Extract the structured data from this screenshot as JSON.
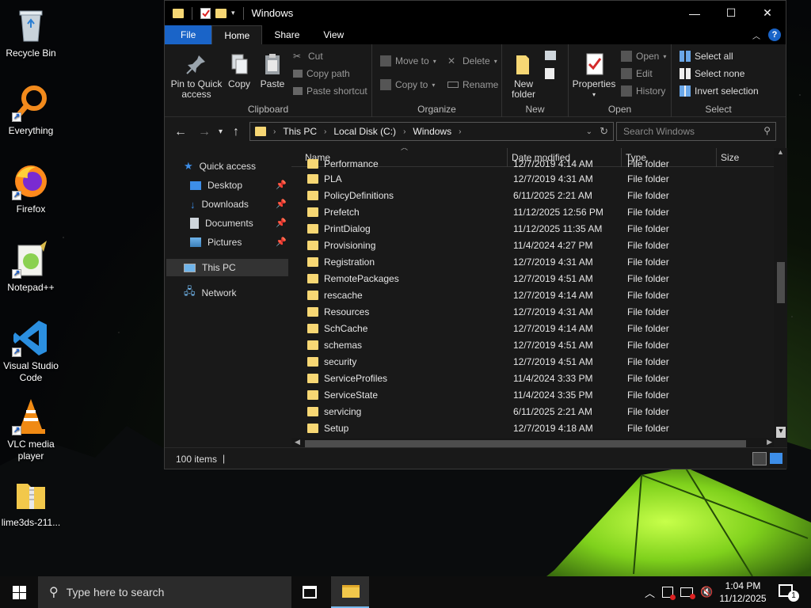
{
  "desktop": {
    "icons": [
      {
        "label": "Recycle Bin"
      },
      {
        "label": "Everything"
      },
      {
        "label": "Firefox"
      },
      {
        "label": "Notepad++"
      },
      {
        "label": "Visual Studio Code"
      },
      {
        "label": "VLC media player"
      },
      {
        "label": "lime3ds-211..."
      }
    ]
  },
  "window": {
    "title": "Windows",
    "controls": {
      "minimize": "—",
      "maximize": "☐",
      "close": "✕"
    }
  },
  "ribbon_tabs": [
    "File",
    "Home",
    "Share",
    "View"
  ],
  "ribbon": {
    "clipboard": {
      "label": "Clipboard",
      "pin": "Pin to Quick access",
      "copy": "Copy",
      "paste": "Paste",
      "cut": "Cut",
      "copy_path": "Copy path",
      "paste_shortcut": "Paste shortcut"
    },
    "organize": {
      "label": "Organize",
      "move_to": "Move to",
      "copy_to": "Copy to",
      "delete": "Delete",
      "rename": "Rename"
    },
    "new": {
      "label": "New",
      "new_folder": "New folder"
    },
    "open": {
      "label": "Open",
      "properties": "Properties",
      "open": "Open",
      "edit": "Edit",
      "history": "History"
    },
    "select": {
      "label": "Select",
      "select_all": "Select all",
      "select_none": "Select none",
      "invert": "Invert selection"
    }
  },
  "address": {
    "crumbs": [
      "This PC",
      "Local Disk (C:)",
      "Windows"
    ],
    "search_placeholder": "Search Windows"
  },
  "nav": {
    "quick_access": "Quick access",
    "items": [
      "Desktop",
      "Downloads",
      "Documents",
      "Pictures"
    ],
    "this_pc": "This PC",
    "network": "Network"
  },
  "columns": [
    "Name",
    "Date modified",
    "Type",
    "Size"
  ],
  "partial_row": {
    "name": "Performance",
    "date": "12/7/2019 4:14 AM",
    "type": "File folder"
  },
  "files": [
    {
      "name": "PLA",
      "date": "12/7/2019 4:31 AM",
      "type": "File folder"
    },
    {
      "name": "PolicyDefinitions",
      "date": "6/11/2025 2:21 AM",
      "type": "File folder"
    },
    {
      "name": "Prefetch",
      "date": "11/12/2025 12:56 PM",
      "type": "File folder"
    },
    {
      "name": "PrintDialog",
      "date": "11/12/2025 11:35 AM",
      "type": "File folder"
    },
    {
      "name": "Provisioning",
      "date": "11/4/2024 4:27 PM",
      "type": "File folder"
    },
    {
      "name": "Registration",
      "date": "12/7/2019 4:31 AM",
      "type": "File folder"
    },
    {
      "name": "RemotePackages",
      "date": "12/7/2019 4:51 AM",
      "type": "File folder"
    },
    {
      "name": "rescache",
      "date": "12/7/2019 4:14 AM",
      "type": "File folder"
    },
    {
      "name": "Resources",
      "date": "12/7/2019 4:31 AM",
      "type": "File folder"
    },
    {
      "name": "SchCache",
      "date": "12/7/2019 4:14 AM",
      "type": "File folder"
    },
    {
      "name": "schemas",
      "date": "12/7/2019 4:51 AM",
      "type": "File folder"
    },
    {
      "name": "security",
      "date": "12/7/2019 4:51 AM",
      "type": "File folder"
    },
    {
      "name": "ServiceProfiles",
      "date": "11/4/2024 3:33 PM",
      "type": "File folder"
    },
    {
      "name": "ServiceState",
      "date": "11/4/2024 3:35 PM",
      "type": "File folder"
    },
    {
      "name": "servicing",
      "date": "6/11/2025 2:21 AM",
      "type": "File folder"
    },
    {
      "name": "Setup",
      "date": "12/7/2019 4:18 AM",
      "type": "File folder"
    }
  ],
  "status": {
    "count": "100 items",
    "divider": "|"
  },
  "taskbar": {
    "search_placeholder": "Type here to search",
    "time": "1:04 PM",
    "date": "11/12/2025",
    "notification_count": "1"
  },
  "colors": {
    "accent": "#1a64c8",
    "folder": "#f7d774",
    "window_bg": "#191919"
  }
}
